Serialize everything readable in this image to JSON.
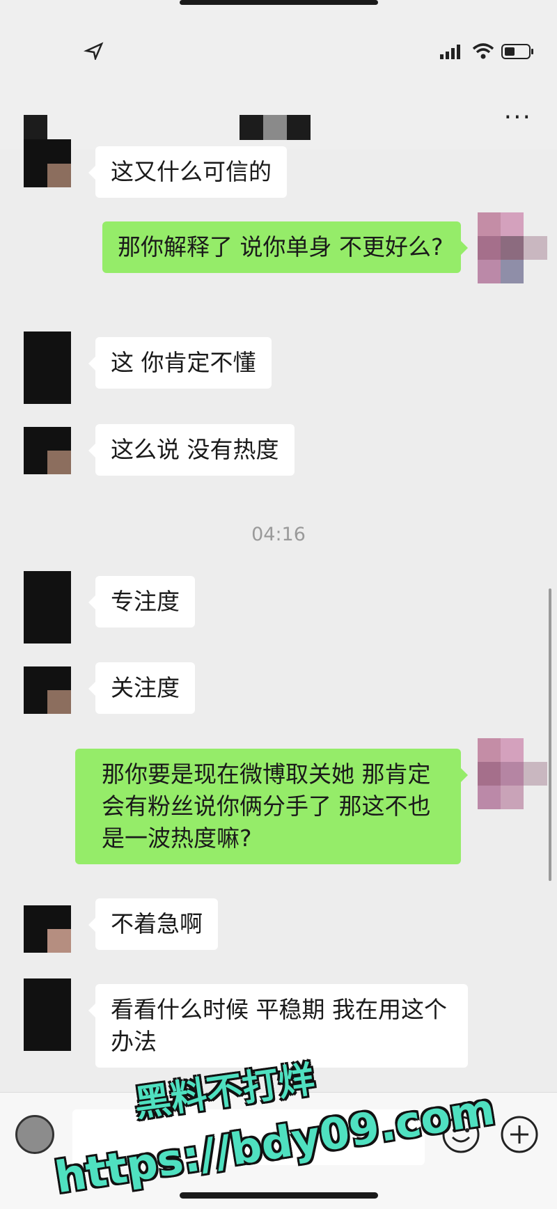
{
  "header": {
    "more_label": "···"
  },
  "messages": [
    {
      "side": "left",
      "text": "这又什么可信的"
    },
    {
      "side": "right",
      "text": "那你解释了 说你单身 不更好么?"
    },
    {
      "side": "left",
      "text": "这 你肯定不懂"
    },
    {
      "side": "left",
      "text": "这么说  没有热度"
    },
    {
      "side": "left",
      "text": "专注度"
    },
    {
      "side": "left",
      "text": "关注度"
    },
    {
      "side": "right",
      "text": "那你要是现在微博取关她 那肯定会有粉丝说你俩分手了 那这不也是一波热度嘛?"
    },
    {
      "side": "left",
      "text": "不着急啊"
    },
    {
      "side": "left",
      "text": "看看什么时候  平稳期   我在用这个办法"
    }
  ],
  "timestamp": "04:16",
  "watermark": {
    "line1": "黑料不打烊",
    "line2": "https://bdy09.com"
  },
  "icons": {
    "voice": "voice-icon",
    "emoji": "emoji-icon",
    "plus": "plus-icon"
  },
  "colors": {
    "sent_bubble": "#95ec69",
    "received_bubble": "#ffffff",
    "background": "#ededed"
  }
}
